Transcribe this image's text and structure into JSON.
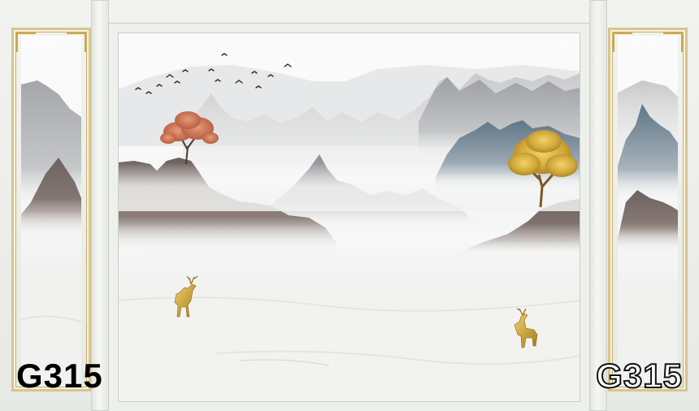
{
  "product": {
    "code_left": "G315",
    "code_right": "G315"
  },
  "colors": {
    "gold": "#c9a23a",
    "mist": "#f3f4f2",
    "stone_brown": "#7d6e6a",
    "stone_grey": "#9a9c9f",
    "stone_blue": "#6f8393",
    "autumn_tree": "#c9704e"
  },
  "scene": {
    "elements": [
      "mountains",
      "mist",
      "flying-birds",
      "golden-tree",
      "autumn-tree",
      "golden-deer"
    ]
  }
}
